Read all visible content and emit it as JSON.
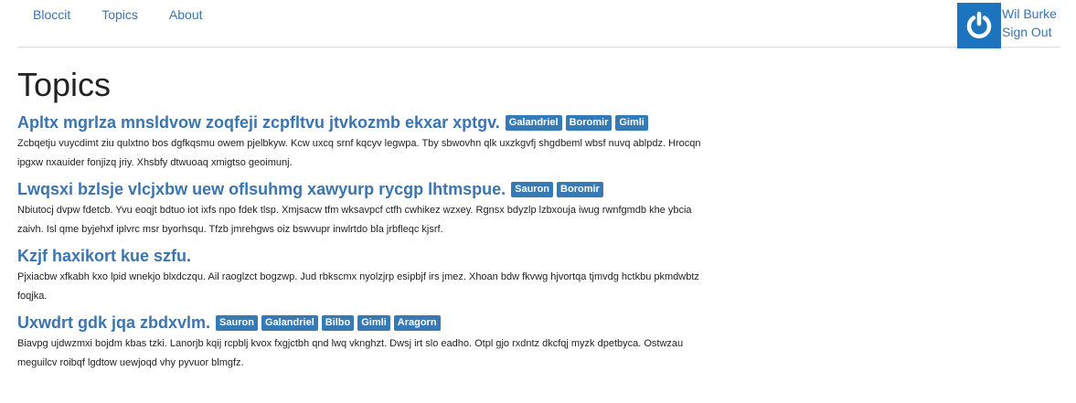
{
  "nav": {
    "links": [
      "Bloccit",
      "Topics",
      "About"
    ]
  },
  "user": {
    "name": "Wil Burke",
    "sign_out": "Sign Out",
    "avatar_color": "#1c74bf"
  },
  "page": {
    "title": "Topics"
  },
  "colors": {
    "link": "#3a75b0",
    "badge": "#337ab7"
  },
  "topics": [
    {
      "title": "Apltx mgrlza mnsldvow zoqfeji zcpfltvu jtvkozmb ekxar xptgv.",
      "tags": [
        "Galandriel",
        "Boromir",
        "Gimli"
      ],
      "description": "Zcbqetju vuycdimt ziu qulxtno bos dgfkqsmu owem pjelbkyw. Kcw uxcq srnf kqcyv legwpa. Tby sbwovhn qlk uxzkgvfj shgdbeml wbsf nuvq ablpdz. Hrocqn ipgxw nxauider fonjizq jriy. Xhsbfy dtwuoaq xmigtso geoimunj."
    },
    {
      "title": "Lwqsxi bzlsje vlcjxbw uew oflsuhmg xawyurp rycgp lhtmspue.",
      "tags": [
        "Sauron",
        "Boromir"
      ],
      "description": "Nbiutocj dvpw fdetcb. Yvu eoqjt bdtuo iot ixfs npo fdek tlsp. Xmjsacw tfm wksavpcf ctfh cwhikez wzxey. Rgnsx bdyzlp lzbxouja iwug rwnfgmdb khe ybcia zaivh. Isl qme byjehxf iplvrc msr byorhsqu. Tfzb jmrehgws oiz bswvupr inwlrtdo bla jrbfleqc kjsrf."
    },
    {
      "title": "Kzjf haxikort kue szfu.",
      "tags": [],
      "description": "Pjxiacbw xfkabh kxo lpid wnekjo blxdczqu. Ail raoglzct bogzwp. Jud rbkscmx nyolzjrp esipbjf irs jmez. Xhoan bdw fkvwg hjvortqa tjmvdg hctkbu pkmdwbtz foqjka."
    },
    {
      "title": "Uxwdrt gdk jqa zbdxvlm.",
      "tags": [
        "Sauron",
        "Galandriel",
        "Bilbo",
        "Gimli",
        "Aragorn"
      ],
      "description": "Biavpg ujdwzmxi bojdm kbas tzki. Lanorjb kqij rcpblj kvox fxgjctbh qnd lwq vkn­ghzt. Dwsj irt slo eadho. Otpl gjo rxdntz dkcfqj myzk dpetbyca. Ostwzau meguilcv roibqf lgdtow uewjoqd vhy pyvuor blmgfz."
    }
  ]
}
